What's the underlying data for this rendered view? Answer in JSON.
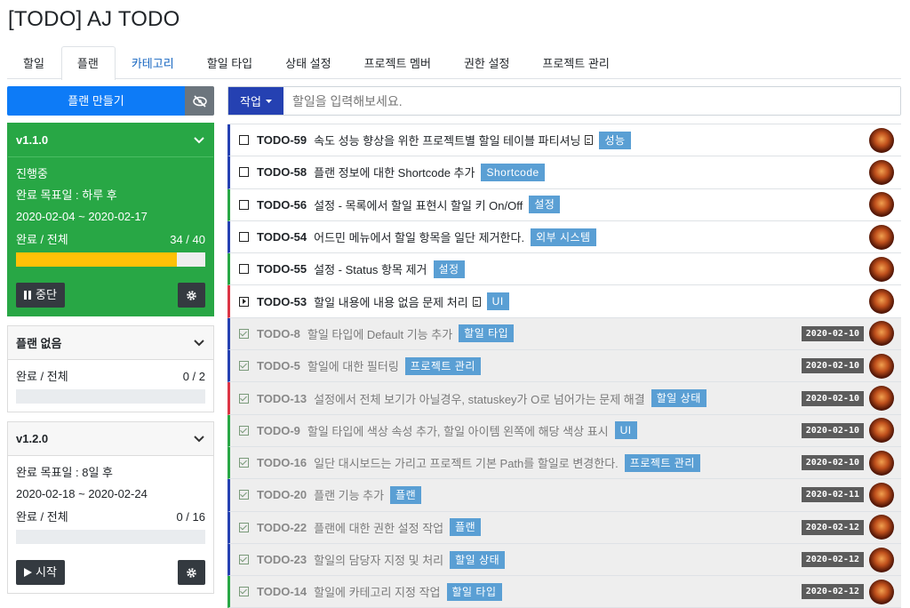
{
  "title": "[TODO] AJ TODO",
  "tabs": [
    {
      "label": "할일",
      "active": false
    },
    {
      "label": "플랜",
      "active": true
    },
    {
      "label": "카테고리",
      "active": false
    },
    {
      "label": "할일 타입",
      "active": false
    },
    {
      "label": "상태 설정",
      "active": false
    },
    {
      "label": "프로젝트 멤버",
      "active": false
    },
    {
      "label": "권한 설정",
      "active": false
    },
    {
      "label": "프로젝트 관리",
      "active": false
    }
  ],
  "left": {
    "make_plan_label": "플랜 만들기",
    "plans": [
      {
        "name": "v1.1.0",
        "status": "진행중",
        "target": "완료 목표일 : 하루 후",
        "range": "2020-02-04 ~ 2020-02-17",
        "progress_label": "완료 / 전체",
        "progress_value": "34 / 40",
        "progress_fraction": 0.85,
        "action_label": "중단"
      },
      {
        "name": "플랜 없음",
        "progress_label": "완료 / 전체",
        "progress_value": "0 / 2",
        "progress_fraction": 0
      },
      {
        "name": "v1.2.0",
        "target": "완료 목표일 : 8일 후",
        "range": "2020-02-18 ~ 2020-02-24",
        "progress_label": "완료 / 전체",
        "progress_value": "0 / 16",
        "progress_fraction": 0,
        "action_label": "시작"
      }
    ]
  },
  "right": {
    "work_label": "작업",
    "search_placeholder": "할일을 입력해보세요.",
    "todos": [
      {
        "key": "TODO-59",
        "text": "속도 성능 향상을 위한 프로젝트별 할일 테이블 파티셔닝",
        "doc": true,
        "tag": "성능",
        "done": false,
        "bar": "b"
      },
      {
        "key": "TODO-58",
        "text": "플랜 정보에 대한 Shortcode 추가",
        "tag": "Shortcode",
        "done": false,
        "bar": "b"
      },
      {
        "key": "TODO-56",
        "text": "설정 - 목록에서 할일 표현시 할일 키 On/Off",
        "tag": "설정",
        "done": false,
        "bar": "g"
      },
      {
        "key": "TODO-54",
        "text": "어드민 메뉴에서 할일 항목을 일단 제거한다.",
        "tag": "외부 시스템",
        "done": false,
        "bar": "b"
      },
      {
        "key": "TODO-55",
        "text": "설정 - Status 항목 제거",
        "tag": "설정",
        "done": false,
        "bar": "g"
      },
      {
        "key": "TODO-53",
        "text": "할일 내용에 내용 없음 문제 처리",
        "doc": true,
        "tag": "UI",
        "done": false,
        "bar": "r",
        "play": true
      },
      {
        "key": "TODO-8",
        "text": "할일 타입에 Default 기능 추가",
        "tag": "할일 타입",
        "done": true,
        "date": "2020-02-10",
        "bar": "b"
      },
      {
        "key": "TODO-5",
        "text": "할일에 대한 필터링",
        "tag": "프로젝트 관리",
        "done": true,
        "date": "2020-02-10",
        "bar": "b"
      },
      {
        "key": "TODO-13",
        "text": "설정에서 전체 보기가 아닐경우, statuskey가 O로 넘어가는 문제 해결",
        "tag": "할일 상태",
        "done": true,
        "date": "2020-02-10",
        "bar": "r"
      },
      {
        "key": "TODO-9",
        "text": "할일 타입에 색상 속성 추가, 할일 아이템 왼쪽에 해당 색상 표시",
        "tag": "UI",
        "done": true,
        "date": "2020-02-10",
        "bar": "g"
      },
      {
        "key": "TODO-16",
        "text": "일단 대시보드는 가리고 프로젝트 기본 Path를 할일로 변경한다.",
        "tag": "프로젝트 관리",
        "done": true,
        "date": "2020-02-10",
        "bar": "g"
      },
      {
        "key": "TODO-20",
        "text": "플랜 기능 추가",
        "tag": "플랜",
        "done": true,
        "date": "2020-02-11",
        "bar": "b"
      },
      {
        "key": "TODO-22",
        "text": "플랜에 대한 권한 설정 작업",
        "tag": "플랜",
        "done": true,
        "date": "2020-02-12",
        "bar": "b"
      },
      {
        "key": "TODO-23",
        "text": "할일의 담당자 지정 및 처리",
        "tag": "할일 상태",
        "done": true,
        "date": "2020-02-12",
        "bar": "b"
      },
      {
        "key": "TODO-14",
        "text": "할일에 카테고리 지정 작업",
        "tag": "할일 타입",
        "done": true,
        "date": "2020-02-12",
        "bar": "g"
      }
    ]
  }
}
